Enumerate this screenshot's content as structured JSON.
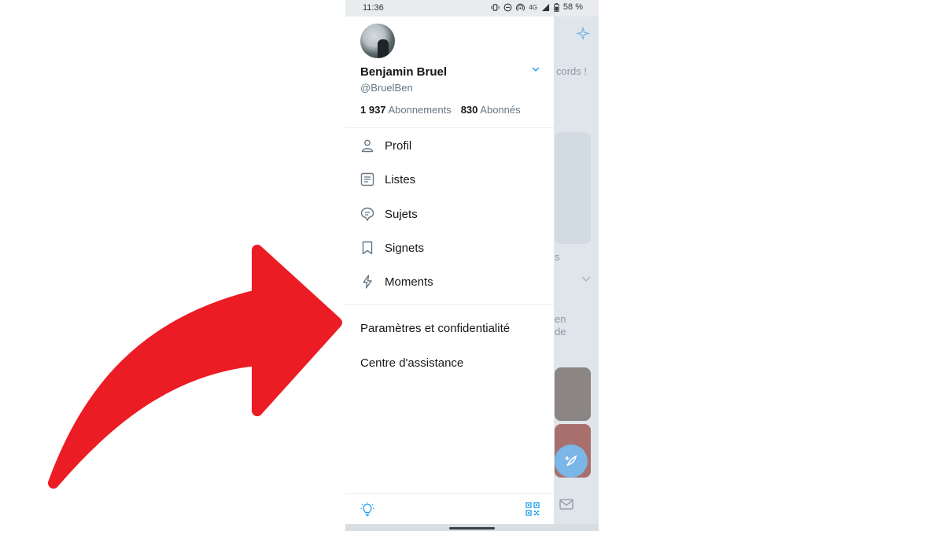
{
  "status_bar": {
    "time": "11:36",
    "network": "4G",
    "battery": "58 %"
  },
  "profile": {
    "display_name": "Benjamin Bruel",
    "handle": "@BruelBen",
    "following_count": "1 937",
    "following_label": "Abonnements",
    "followers_count": "830",
    "followers_label": "Abonnés"
  },
  "menu": {
    "items": [
      {
        "label": "Profil",
        "icon": "person-icon"
      },
      {
        "label": "Listes",
        "icon": "list-icon"
      },
      {
        "label": "Sujets",
        "icon": "topics-icon"
      },
      {
        "label": "Signets",
        "icon": "bookmark-icon"
      },
      {
        "label": "Moments",
        "icon": "lightning-icon"
      }
    ],
    "settings_label": "Paramètres et confidentialité",
    "help_label": "Centre d'assistance"
  },
  "background_app": {
    "text_1": "cords !",
    "text_2": "en",
    "text_3": "de",
    "text_4": "s"
  },
  "colors": {
    "accent": "#1da1f2",
    "arrow": "#ec1c24",
    "text": "#14171a",
    "muted": "#657786"
  }
}
